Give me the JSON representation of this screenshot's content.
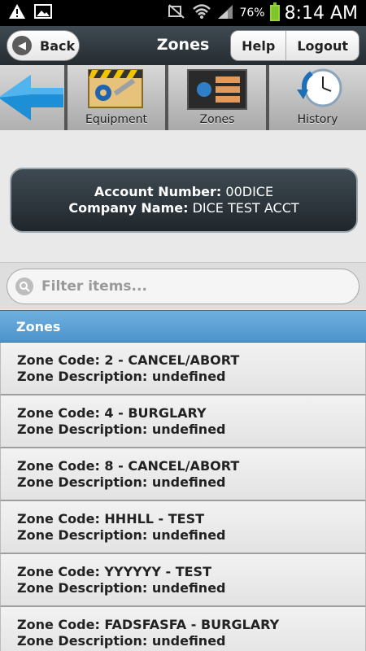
{
  "status_bar": {
    "battery_percent": "76%",
    "time": "8:14 AM"
  },
  "header": {
    "back_label": "Back",
    "title": "Zones",
    "help_label": "Help",
    "logout_label": "Logout"
  },
  "toolbar": {
    "items": [
      {
        "label": "",
        "icon": "back-arrow-icon"
      },
      {
        "label": "Equipment",
        "icon": "equipment-icon"
      },
      {
        "label": "Zones",
        "icon": "zones-icon"
      },
      {
        "label": "History",
        "icon": "history-clock-icon"
      }
    ]
  },
  "account": {
    "account_number_label": "Account Number:",
    "account_number_value": "00DICE",
    "company_name_label": "Company Name:",
    "company_name_value": "DICE TEST ACCT"
  },
  "filter": {
    "placeholder": "Filter items..."
  },
  "list": {
    "header": "Zones",
    "items": [
      {
        "code": "Zone Code: 2 - CANCEL/ABORT",
        "description": "Zone Description: undefined"
      },
      {
        "code": "Zone Code: 4 - BURGLARY",
        "description": "Zone Description: undefined"
      },
      {
        "code": "Zone Code: 8 - CANCEL/ABORT",
        "description": "Zone Description: undefined"
      },
      {
        "code": "Zone Code: HHHLL - TEST",
        "description": "Zone Description: undefined"
      },
      {
        "code": "Zone Code: YYYYYY - TEST",
        "description": "Zone Description: undefined"
      },
      {
        "code": "Zone Code: FADSFASFA - BURGLARY",
        "description": "Zone Description: undefined"
      }
    ]
  },
  "colors": {
    "header_bg": "#2b3338",
    "list_header_bg": "#5aa0d4",
    "accent_arrow": "#1d8fd6"
  }
}
